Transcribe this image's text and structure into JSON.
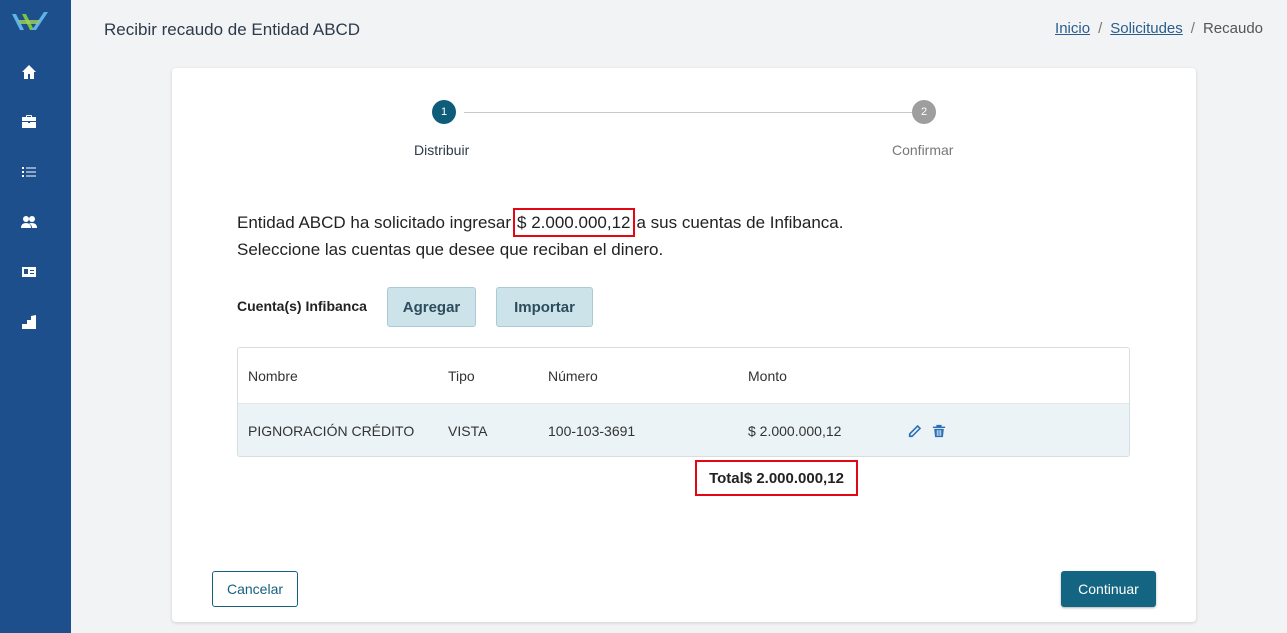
{
  "header": {
    "title": "Recibir recaudo de Entidad ABCD",
    "breadcrumb": {
      "home": "Inicio",
      "sep1": "/",
      "requests": "Solicitudes",
      "sep2": "/",
      "current": "Recaudo"
    }
  },
  "sidebar": {
    "items": [
      {
        "icon": "home-icon"
      },
      {
        "icon": "briefcase-icon"
      },
      {
        "icon": "list-icon"
      },
      {
        "icon": "users-icon"
      },
      {
        "icon": "id-card-icon"
      },
      {
        "icon": "building-icon"
      }
    ]
  },
  "stepper": {
    "steps": [
      {
        "number": "1",
        "label": "Distribuir",
        "active": true
      },
      {
        "number": "2",
        "label": "Confirmar",
        "active": false
      }
    ]
  },
  "message": {
    "line1_prefix": "Entidad ABCD ha solicitado ingresar",
    "amount": "$ 2.000.000,12",
    "line1_suffix": "a sus cuentas de Infibanca.",
    "line2": "Seleccione las cuentas que desee que reciban el dinero."
  },
  "accounts": {
    "label": "Cuenta(s) Infibanca",
    "add_label": "Agregar",
    "import_label": "Importar"
  },
  "table": {
    "columns": [
      "Nombre",
      "Tipo",
      "Número",
      "Monto"
    ],
    "rows": [
      {
        "nombre": "PIGNORACIÓN CRÉDITO",
        "tipo": "VISTA",
        "numero": "100-103-3691",
        "monto": "$ 2.000.000,12"
      }
    ]
  },
  "total": {
    "label": "Total",
    "value": "$ 2.000.000,12"
  },
  "footer": {
    "cancel_label": "Cancelar",
    "continue_label": "Continuar"
  },
  "colors": {
    "sidebar": "#1d4f8c",
    "primary": "#146582",
    "highlight": "#e30613"
  }
}
